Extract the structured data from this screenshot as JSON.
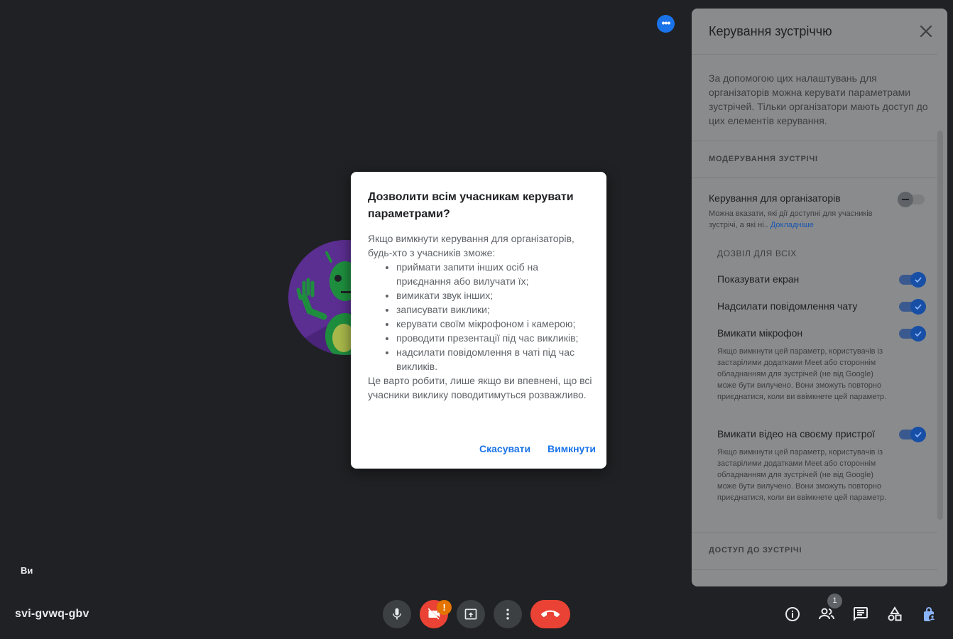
{
  "meeting": {
    "code": "svi-gvwq-gbv",
    "self_label": "Ви",
    "people_count": "1",
    "camera_warning": "!"
  },
  "panel": {
    "title": "Керування зустріччю",
    "intro": "За допомогою цих налаштувань для організаторів можна керувати параметрами зустрічей. Тільки організатори мають доступ до цих елементів керування.",
    "section_moderation": "МОДЕРУВАННЯ ЗУСТРІЧІ",
    "host_controls": {
      "title": "Керування для організаторів",
      "desc": "Можна вказати, які дії доступні для учасників зустрічі, а які ні..",
      "link": "Докладніше",
      "enabled": false
    },
    "allow_all_head": "ДОЗВІЛ ДЛЯ ВСІХ",
    "settings": [
      {
        "title": "Показувати екран",
        "enabled": true
      },
      {
        "title": "Надсилати повідомлення чату",
        "enabled": true
      },
      {
        "title": "Вмикати мікрофон",
        "enabled": true,
        "desc": "Якщо вимкнути цей параметр, користувачів із застарілими додатками Meet або стороннім обладнанням для зустрічей (не від Google) може бути вилучено. Вони зможуть повторно приєднатися, коли ви ввімкнете цей параметр."
      },
      {
        "title": "Вмикати відео на своєму пристрої",
        "enabled": true,
        "desc": "Якщо вимкнути цей параметр, користувачів із застарілими додатками Meet або стороннім обладнанням для зустрічей (не від Google) може бути вилучено. Вони зможуть повторно приєднатися, коли ви ввімкнете цей параметр."
      }
    ],
    "section_access": "ДОСТУП ДО ЗУСТРІЧІ"
  },
  "dialog": {
    "title": "Дозволити всім учасникам керувати параметрами?",
    "intro": "Якщо вимкнути керування для організаторів, будь-хто з учасників зможе:",
    "items": [
      "приймати запити інших осіб на приєднання або вилучати їх;",
      "вимикати звук інших;",
      "записувати виклики;",
      "керувати своїм мікрофоном і камерою;",
      "проводити презентації під час викликів;",
      "надсилати повідомлення в чаті під час викликів."
    ],
    "outro": "Це варто робити, лише якщо ви впевнені, що всі учасники виклику поводитимуться розважливо.",
    "cancel_label": "Скасувати",
    "confirm_label": "Вимкнути"
  },
  "colors": {
    "background": "#202124",
    "accent": "#1a73e8",
    "hangup": "#ea4335",
    "warning": "#e37400"
  }
}
